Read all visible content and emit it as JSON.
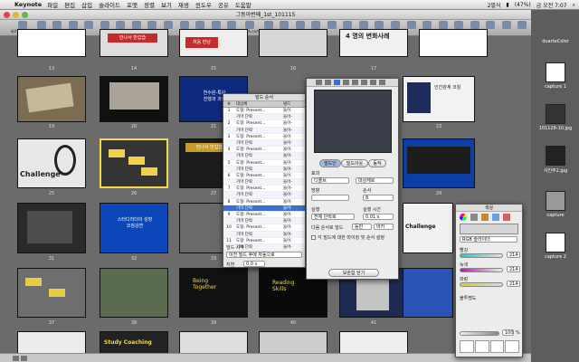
{
  "menubar": {
    "app": "Keynote",
    "items": [
      "파일",
      "편집",
      "삽입",
      "슬라이드",
      "포맷",
      "정렬",
      "보기",
      "재생",
      "윈도우",
      "공유",
      "도움말"
    ],
    "battery": "(47%)",
    "input": "2벌식",
    "clock": "금 오전 7:07"
  },
  "window": {
    "title": "그동아번째_1st_101115"
  },
  "toolbar": {
    "items": [
      "새로운 슬라이드",
      "재생",
      "보기",
      "",
      "",
      "",
      "",
      "",
      "",
      "",
      "",
      "",
      "",
      "",
      "iWork.com",
      "",
      "",
      "마스크",
      "",
      "",
      "",
      "",
      "",
      "보내기",
      "",
      "",
      "",
      "",
      "",
      "",
      "",
      ""
    ]
  },
  "slide_numbers": {
    "row1": [
      "13",
      "14",
      "15",
      "16",
      "17"
    ],
    "row2": [
      "19",
      "20",
      "21",
      "22",
      "23",
      "24"
    ],
    "row3": [
      "25",
      "26",
      "27",
      "28",
      "29",
      "30"
    ],
    "row4": [
      "31",
      "32",
      "33",
      "34",
      "35",
      "36"
    ],
    "row5": [
      "37",
      "38",
      "39",
      "40",
      "41",
      "42"
    ]
  },
  "slide_texts": {
    "s14": "만나서 반갑습",
    "s15": "처음 만남",
    "s20": "연수원-특강\n진행과 과정",
    "s22": "인간관계 코칭",
    "s25": "Challenge",
    "s27": "만나서 반갑습니다",
    "s31": "스터디리더의 성장\n코칭강연",
    "s34": "Being\nTogether",
    "s36": "Challenge",
    "s37": "Study Coaching",
    "s40": "Reading\nSkills",
    "s17": "4 명의 변화사례"
  },
  "dock_items": [
    "duarteColor",
    "capture 1",
    "101128-10.jpg",
    "사진주2.jpg",
    "capture",
    "capture 2"
  ],
  "build_panel": {
    "title": "빌드 순서",
    "headers": [
      "#",
      "대상체",
      "빌드"
    ],
    "rows": [
      [
        "1",
        "도형: Present...",
        "들어-"
      ],
      [
        "",
        "기마 단락",
        "들어-"
      ],
      [
        "2",
        "도형: Present...",
        "들어-"
      ],
      [
        "",
        "기마 단락",
        "들어-"
      ],
      [
        "3",
        "도형: Present...",
        "들어-"
      ],
      [
        "",
        "기마 단락",
        "들어-"
      ],
      [
        "4",
        "도형: Present...",
        "들어-"
      ],
      [
        "",
        "기마 단락",
        "들어-"
      ],
      [
        "5",
        "도형: Present...",
        "들어-"
      ],
      [
        "",
        "기마 단락",
        "들어-"
      ],
      [
        "6",
        "도형: Present...",
        "들어-"
      ],
      [
        "",
        "기마 단락",
        "들어-"
      ],
      [
        "7",
        "도형: Present...",
        "들어-"
      ],
      [
        "",
        "기마 단락",
        "들어-"
      ],
      [
        "8",
        "도형: Present...",
        "들어-"
      ],
      [
        "",
        "기마 단락",
        "들어-"
      ],
      [
        "9",
        "도형: Present...",
        "들어-"
      ],
      [
        "",
        "기마 단락",
        "들어-"
      ],
      [
        "10",
        "도형: Present...",
        "들어-"
      ],
      [
        "",
        "기마 단락",
        "들어-"
      ],
      [
        "11",
        "도형: Present...",
        "들어-"
      ],
      [
        "",
        "기마 단락",
        "들어-"
      ]
    ],
    "selected_index": 15,
    "start_label": "빌드 시작",
    "start_value": "이전 빌드 후에 자동으로",
    "delay_label": "지연",
    "delay_value": "0.0 s"
  },
  "inspector": {
    "tabs": [
      "빌드인",
      "빌드아웃",
      "동작"
    ],
    "effect_label": "효과",
    "effect_value": "디졸브",
    "order_effect": "대상체로",
    "direction_label": "방향",
    "order_label": "순서",
    "order_value": "8",
    "delivery_label": "실행",
    "delivery_value": "전체 단락로",
    "duration_label": "실행 시간",
    "duration_value": "0.01 s",
    "next_label": "다음 순서로 빌드",
    "next_value": "동반",
    "next_extra": "바키",
    "checkbox_label": "각 빌드에 대한 마이킹 및 순서 설정",
    "close_button": "보관함 닫기"
  },
  "colors_panel": {
    "title": "색상",
    "mode": "RGB 슬라이더",
    "red_label": "빨강",
    "green_label": "녹색",
    "blue_label": "파랑",
    "red_value": "214",
    "green_value": "214",
    "blue_value": "214",
    "opacity_label": "불투명도",
    "opacity_value": "100",
    "opacity_unit": "%"
  }
}
